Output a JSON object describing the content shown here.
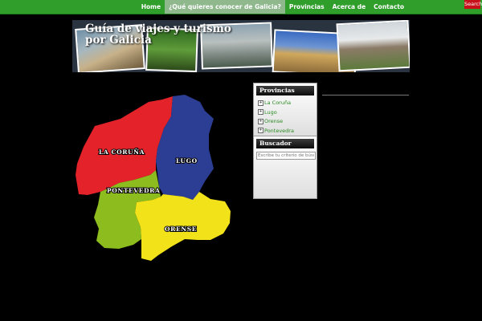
{
  "nav": {
    "items": [
      {
        "label": "Home",
        "active": false
      },
      {
        "label": "¿Qué quieres conocer de Galicia?",
        "active": true
      },
      {
        "label": "Provincias",
        "active": false
      },
      {
        "label": "Acerca de",
        "active": false
      },
      {
        "label": "Contacto",
        "active": false
      }
    ],
    "search_label": "Search"
  },
  "header": {
    "site_title": "Guía de viajes y turismo por Galicia"
  },
  "map": {
    "regions": [
      {
        "label": "LA CORUÑA",
        "color": "#e32229"
      },
      {
        "label": "LUGO",
        "color": "#2c3e94"
      },
      {
        "label": "PONTEVEDRA",
        "color": "#8cbc1e"
      },
      {
        "label": "ORENSE",
        "color": "#f2e21a"
      }
    ]
  },
  "sidebar": {
    "provincias": {
      "title": "Provincias",
      "items": [
        "La Coruña",
        "Lugo",
        "Orense",
        "Pontevedra"
      ]
    },
    "buscador": {
      "title": "Buscador",
      "placeholder": "Escribe tu criterio de búsqueda"
    }
  },
  "colors": {
    "nav_bg": "#2f9e2b",
    "link_green": "#2a8a22",
    "search_red": "#c8101a"
  }
}
